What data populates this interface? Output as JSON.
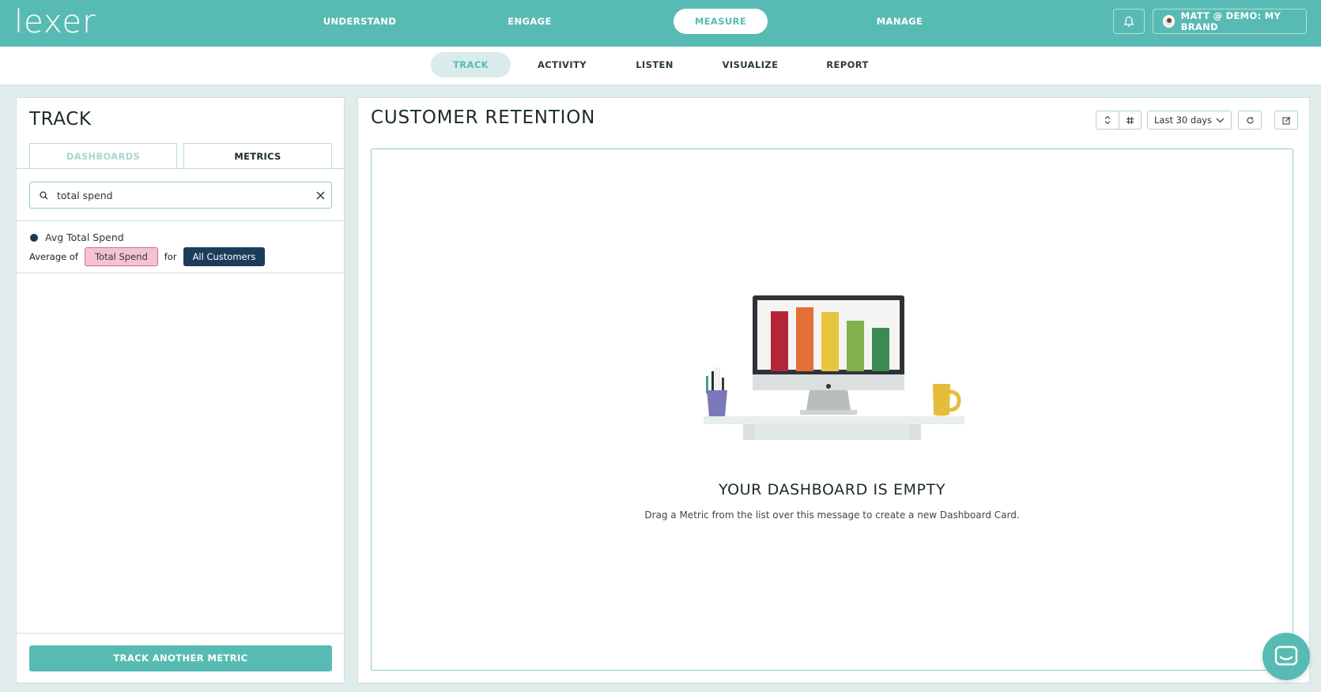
{
  "brand": {
    "logo_text": "lexer"
  },
  "topnav": {
    "items": [
      {
        "label": "UNDERSTAND"
      },
      {
        "label": "ENGAGE"
      },
      {
        "label": "MEASURE"
      },
      {
        "label": "MANAGE"
      }
    ],
    "active": "MEASURE",
    "user_label": "MATT @ DEMO: MY BRAND"
  },
  "subnav": {
    "items": [
      {
        "label": "TRACK"
      },
      {
        "label": "ACTIVITY"
      },
      {
        "label": "LISTEN"
      },
      {
        "label": "VISUALIZE"
      },
      {
        "label": "REPORT"
      }
    ],
    "active": "TRACK"
  },
  "left_panel": {
    "title": "TRACK",
    "tabs": [
      {
        "label": "DASHBOARDS",
        "active": false
      },
      {
        "label": "METRICS",
        "active": true
      }
    ],
    "search": {
      "value": "total spend",
      "placeholder": "Search metrics"
    },
    "metric": {
      "name": "Avg Total Spend",
      "prefix": "Average of",
      "attribute": "Total Spend",
      "connector": "for",
      "segment": "All Customers",
      "dot_color": "#1d3557"
    },
    "track_button": "TRACK ANOTHER METRIC"
  },
  "right_panel": {
    "title": "CUSTOMER RETENTION",
    "date_range": "Last 30 days",
    "empty_title": "YOUR DASHBOARD IS EMPTY",
    "empty_message": "Drag a Metric from the list over this message to create a new Dashboard Card."
  },
  "colors": {
    "accent": "#58bbb3",
    "navy": "#1d3c5c",
    "pink": "#f4c3d3"
  },
  "icons": {
    "bell": "bell-icon",
    "search": "search-icon",
    "clear": "close-icon",
    "sort": "sort-icon",
    "grid": "hash-icon",
    "chevron": "chevron-down-icon",
    "refresh": "refresh-icon",
    "edit": "edit-icon",
    "chat": "chat-icon"
  }
}
